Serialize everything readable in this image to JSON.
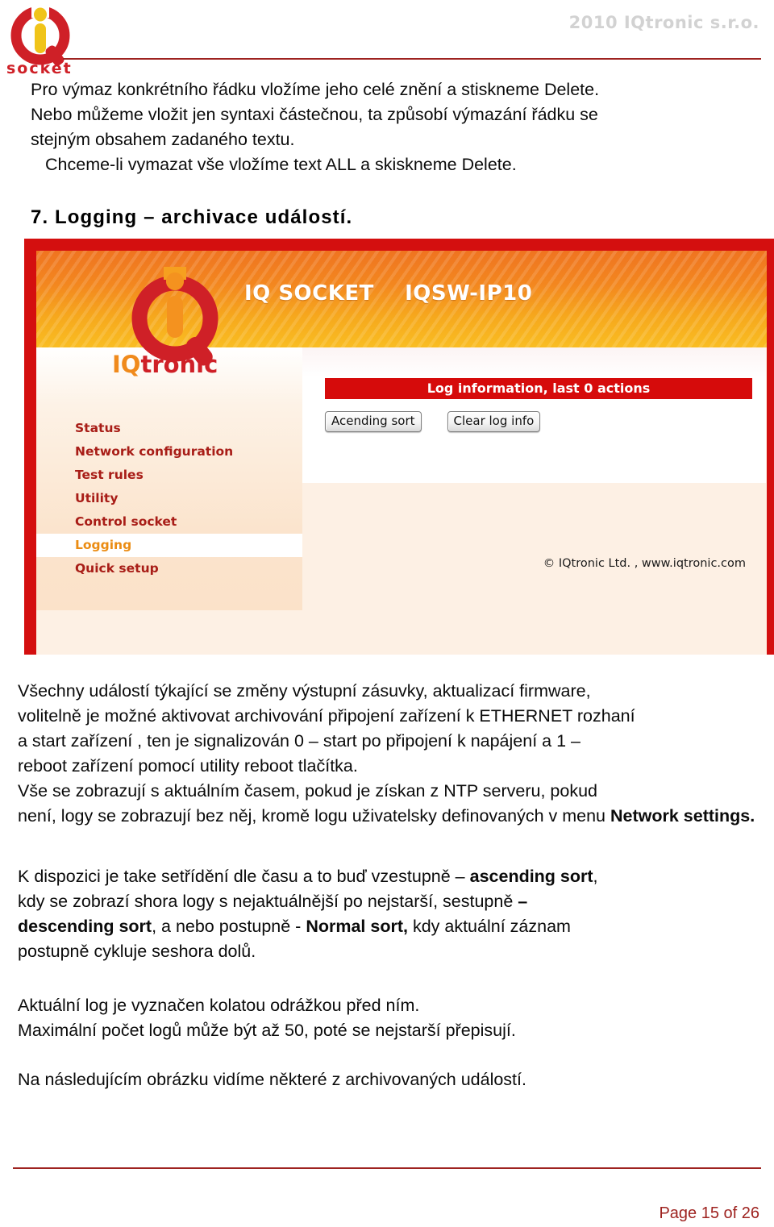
{
  "header": {
    "logo_alt": "iq-socket-logo",
    "logo_word": "socket",
    "company": "2010 IQtronic  s.r.o.",
    "colors": {
      "rule": "#9e2320",
      "logo_red": "#cf2027",
      "logo_gold": "#f0c419",
      "company_gray": "#d2d2d2"
    }
  },
  "intro": {
    "line1": "Pro výmaz konkrétního  řádku  vložíme jeho celé znění a stiskneme Delete.",
    "line2": "Nebo můžeme vložit jen syntaxi částečnou, ta způsobí výmazání řádku se",
    "line3": "stejným obsahem zadaného textu.",
    "line4": "Chceme-li  vymazat vše vložíme text ALL a skiskneme Delete."
  },
  "section": {
    "heading": "7. Logging – archivace událostí."
  },
  "device": {
    "banner_title": "IQ SOCKET    IQSW-IP10",
    "logo_alt": "iqtronic-logo",
    "logo_word_iq": "IQ",
    "logo_word_tronic": "tronic",
    "nav": [
      {
        "label": "Status",
        "active": false
      },
      {
        "label": "Network configuration",
        "active": false
      },
      {
        "label": "Test rules",
        "active": false
      },
      {
        "label": "Utility",
        "active": false
      },
      {
        "label": "Control socket",
        "active": false
      },
      {
        "label": "Logging",
        "active": true
      },
      {
        "label": "Quick setup",
        "active": false
      }
    ],
    "log_bar": "Log information, last 0 actions",
    "buttons": {
      "sort": "Acending sort",
      "clear": "Clear log info"
    },
    "footer": "© IQtronic Ltd. , www.iqtronic.com",
    "colors": {
      "border_red": "#d40f0f",
      "bar_red": "#d60b0b",
      "nav_red": "#a81d17",
      "nav_active_orange": "#eb8c13",
      "banner_top": "#ef7420",
      "banner_bottom": "#f9bd22",
      "page_peach": "#fdf0e4"
    }
  },
  "body_text": {
    "p1_l1": "Všechny událostí týkající se změny výstupní zásuvky, aktualizací firmware,",
    "p1_l2": "volitelně je možné aktivovat archivování připojení zařízení k ETHERNET rozhaní",
    "p1_l3": "a start zařízení , ten je signalizován  0 – start po připojení k napájení a 1 –",
    "p1_l4": "reboot zařízení pomocí utility reboot tlačítka.",
    "p1_l5": "Vše se zobrazují s aktuálním časem, pokud je získan z NTP serveru, pokud",
    "p1_l6_a": "není, logy se zobrazují bez něj, kromě logu uživatelsky definovaných v menu ",
    "p1_l6_b": "Network settings.",
    "p2_l1_a": "K dispozici je take setřídění dle času a to buď vzestupně – ",
    "p2_l1_b": "ascending sort",
    "p2_l1_c": ",",
    "p2_l2_a": "kdy se zobrazí shora logy s nejaktuálnější po nejstarší, sestupně ",
    "p2_l2_b": "–",
    "p2_l3_a": "descending sort",
    "p2_l3_b": ", a nebo postupně - ",
    "p2_l3_c": "Normal sort,",
    "p2_l3_d": " kdy aktuální záznam",
    "p2_l4": "postupně cykluje seshora dolů.",
    "p3_l1": "Aktuální log je vyznačen  kolatou odrážkou před ním.",
    "p3_l2": "Maximální počet logů může být až 50, poté se nejstarší přepisují.",
    "p4_l1": "Na následujícím obrázku vidíme některé z archivovaných událostí."
  },
  "footer": {
    "page_number": "Page 15 of 26"
  }
}
